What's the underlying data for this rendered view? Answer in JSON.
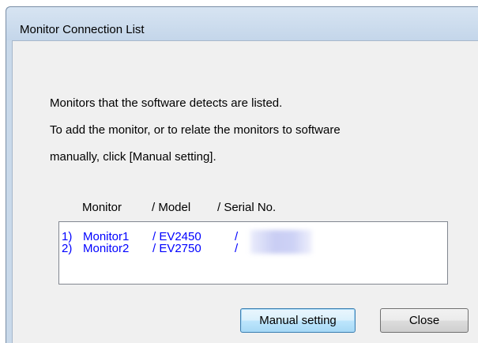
{
  "window": {
    "title": "Monitor Connection List"
  },
  "description": {
    "lines": [
      "Monitors that the software detects are listed.",
      "To add the monitor, or to relate the monitors to software",
      "manually, click [Manual setting]."
    ]
  },
  "list": {
    "headers": {
      "monitor": "Monitor",
      "model": "/ Model",
      "serial": "/ Serial No."
    },
    "rows": [
      {
        "index": "1)",
        "monitor": "Monitor1",
        "model": "/ EV2450",
        "serial_sep": "/"
      },
      {
        "index": "2)",
        "monitor": "Monitor2",
        "model": "/ EV2750",
        "serial_sep": "/"
      }
    ]
  },
  "buttons": {
    "manual_setting": "Manual setting",
    "close": "Close"
  },
  "colors": {
    "list_text": "#0000ff",
    "client_background": "#f0f0f0",
    "titlebar": "#c9d9ea"
  }
}
